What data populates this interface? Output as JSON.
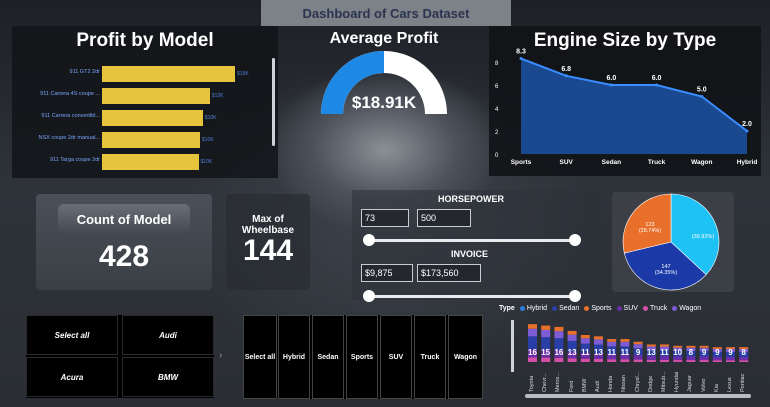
{
  "header": {
    "title": "Dashboard of Cars Dataset"
  },
  "profit_by_model": {
    "title": "Profit by Model",
    "bars": [
      {
        "label": "911 GT2 2dr",
        "value": 0.95,
        "value_label": "$19K"
      },
      {
        "label": "911 Carrera 4S coupe ...",
        "value": 0.77,
        "value_label": "$12K"
      },
      {
        "label": "911 Carrera convertibl...",
        "value": 0.72,
        "value_label": "$10K"
      },
      {
        "label": "NSX coupe 2dr manual...",
        "value": 0.7,
        "value_label": "$10K"
      },
      {
        "label": "911 Targa coupe 2dr",
        "value": 0.69,
        "value_label": "$10K"
      }
    ]
  },
  "average_profit": {
    "title": "Average Profit",
    "value": "$18.91K",
    "gauge_fraction": 0.5,
    "colors": {
      "fill": "#1e88e5",
      "empty": "#ffffff"
    }
  },
  "engine_size": {
    "title": "Engine Size by Type",
    "y_ticks": [
      "0",
      "2",
      "4",
      "6",
      "8"
    ]
  },
  "chart_data": [
    {
      "type": "area",
      "title": "Engine Size by Type",
      "categories": [
        "Sports",
        "SUV",
        "Sedan",
        "Truck",
        "Wagon",
        "Hybrid"
      ],
      "values": [
        8.3,
        6.8,
        6.0,
        6.0,
        5.0,
        2.0
      ],
      "value_labels": [
        "8.3",
        "6.8",
        "6.0",
        "6.0",
        "5.0",
        "2.0"
      ],
      "ylim": [
        0,
        8
      ]
    },
    {
      "type": "pie",
      "slices": [
        {
          "value": 158,
          "label": "158",
          "pct": "(36.92%)",
          "color": "#1fc2f5"
        },
        {
          "value": 147,
          "label": "147",
          "pct": "(34.35%)",
          "color": "#1b3aa8"
        },
        {
          "value": 123,
          "label": "123",
          "pct": "(28.74%)",
          "color": "#e9702a"
        }
      ]
    },
    {
      "type": "bar",
      "series_legend": [
        {
          "name": "Hybrid",
          "color": "#2f7de0"
        },
        {
          "name": "Sedan",
          "color": "#2a3ea8"
        },
        {
          "name": "Sports",
          "color": "#e9702a"
        },
        {
          "name": "SUV",
          "color": "#6b2ea8"
        },
        {
          "name": "Truck",
          "color": "#d44fa8"
        },
        {
          "name": "Wagon",
          "color": "#7e5cd6"
        }
      ],
      "categories": [
        "Toyota",
        "Chevr...",
        "Merce...",
        "Ford",
        "BMW",
        "Audi",
        "Honda",
        "Nissan",
        "Chrysl...",
        "Dodge",
        "Mitsub...",
        "Hyundai",
        "Jaguar",
        "Volvo",
        "Kia",
        "Lexus",
        "Pontiac"
      ],
      "value_labels": [
        "16",
        "15",
        "16",
        "13",
        "11",
        "13",
        "11",
        "11",
        "9",
        "13",
        "11",
        "10",
        "8",
        "9",
        "9",
        "9",
        "8"
      ],
      "totals": [
        28,
        27,
        26,
        23,
        20,
        19,
        17,
        17,
        15,
        13,
        13,
        12,
        12,
        12,
        11,
        11,
        11
      ]
    }
  ],
  "count_of_model": {
    "label": "Count of Model",
    "value": "428"
  },
  "max_wheelbase": {
    "label": "Max of Wheelbase",
    "value": "144"
  },
  "horsepower": {
    "title": "HORSEPOWER",
    "min": "73",
    "max": "500"
  },
  "invoice": {
    "title": "INVOICE",
    "min": "$9,875",
    "max": "$173,560"
  },
  "legend_label": "Type",
  "make_slicer": {
    "items": [
      "Select all",
      "Audi",
      "Acura",
      "BMW"
    ]
  },
  "type_slicer": {
    "items": [
      "Select all",
      "Hybrid",
      "Sedan",
      "Sports",
      "SUV",
      "Truck",
      "Wagon"
    ]
  },
  "icons": {
    "chevron": "›"
  }
}
